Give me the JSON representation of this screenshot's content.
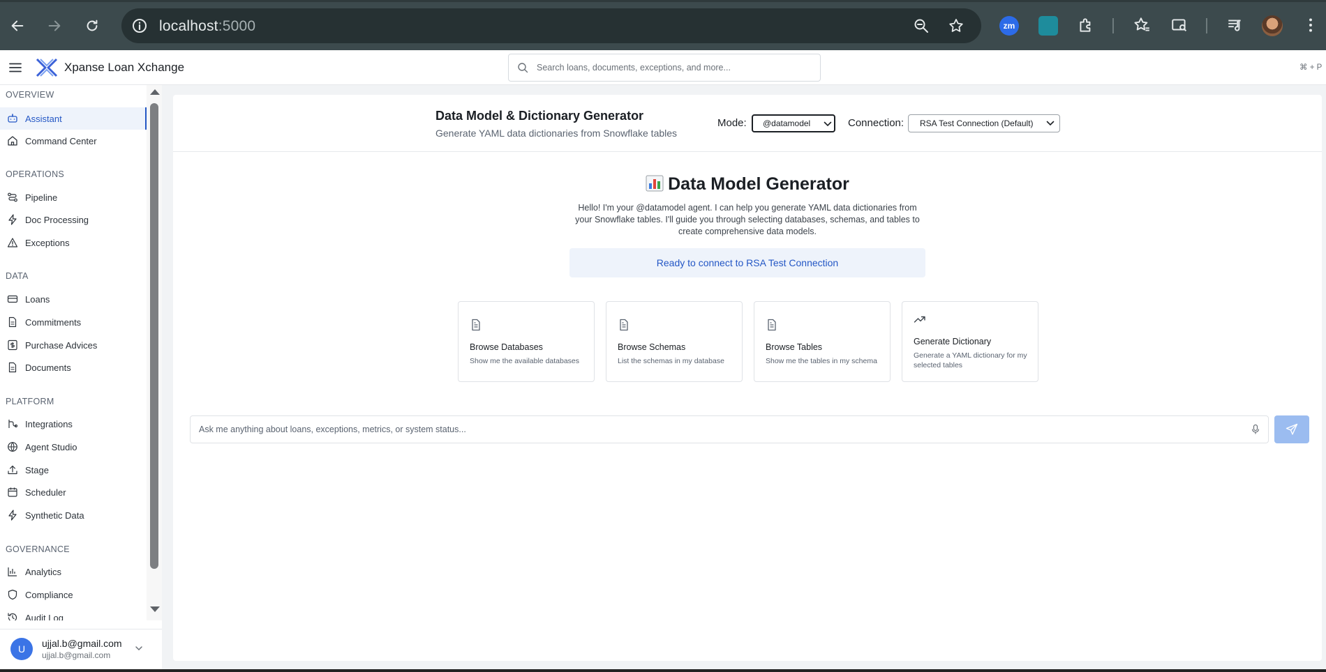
{
  "browser": {
    "url_host": "localhost",
    "url_port": ":5000"
  },
  "header": {
    "brand": "Xpanse Loan Xchange",
    "search_placeholder": "Search loans, documents, exceptions, and more...",
    "shortcut": "⌘ + P"
  },
  "sidebar": {
    "sections": [
      {
        "title": "OVERVIEW",
        "items": [
          {
            "label": "Assistant",
            "icon": "bot-icon",
            "active": true
          },
          {
            "label": "Command Center",
            "icon": "home-icon"
          }
        ]
      },
      {
        "title": "OPERATIONS",
        "items": [
          {
            "label": "Pipeline",
            "icon": "workflow-icon"
          },
          {
            "label": "Doc Processing",
            "icon": "bolt-icon"
          },
          {
            "label": "Exceptions",
            "icon": "warning-icon"
          }
        ]
      },
      {
        "title": "DATA",
        "items": [
          {
            "label": "Loans",
            "icon": "card-icon"
          },
          {
            "label": "Commitments",
            "icon": "file-icon"
          },
          {
            "label": "Purchase Advices",
            "icon": "dollar-icon"
          },
          {
            "label": "Documents",
            "icon": "file-icon"
          }
        ]
      },
      {
        "title": "PLATFORM",
        "items": [
          {
            "label": "Integrations",
            "icon": "integrations-icon"
          },
          {
            "label": "Agent Studio",
            "icon": "globe-icon"
          },
          {
            "label": "Stage",
            "icon": "upload-icon"
          },
          {
            "label": "Scheduler",
            "icon": "calendar-icon"
          },
          {
            "label": "Synthetic Data",
            "icon": "bolt-icon"
          }
        ]
      },
      {
        "title": "GOVERNANCE",
        "items": [
          {
            "label": "Analytics",
            "icon": "bar-chart-icon"
          },
          {
            "label": "Compliance",
            "icon": "shield-icon"
          },
          {
            "label": "Audit Log",
            "icon": "history-icon"
          }
        ]
      }
    ],
    "user": {
      "initial": "U",
      "name": "ujjal.b@gmail.com",
      "email": "ujjal.b@gmail.com"
    }
  },
  "main": {
    "title": "Data Model & Dictionary Generator",
    "subtitle": "Generate YAML data dictionaries from Snowflake tables",
    "mode_label": "Mode:",
    "mode_value": "@datamodel",
    "connection_label": "Connection:",
    "connection_value": "RSA Test Connection (Default)",
    "hero_title": "Data Model Generator",
    "hero_desc": "Hello! I'm your @datamodel agent. I can help you generate YAML data dictionaries from your Snowflake tables. I'll guide you through selecting databases, schemas, and tables to create comprehensive data models.",
    "status": "Ready to connect to RSA Test Connection",
    "cards": [
      {
        "title": "Browse Databases",
        "desc": "Show me the available databases",
        "icon": "document-icon"
      },
      {
        "title": "Browse Schemas",
        "desc": "List the schemas in my database",
        "icon": "document-icon"
      },
      {
        "title": "Browse Tables",
        "desc": "Show me the tables in my schema",
        "icon": "document-icon"
      },
      {
        "title": "Generate Dictionary",
        "desc": "Generate a YAML dictionary for my selected tables",
        "icon": "trending-up-icon"
      }
    ],
    "ask_placeholder": "Ask me anything about loans, exceptions, metrics, or system status..."
  },
  "colors": {
    "accent": "#2457c5",
    "active_bg": "#eef3fb",
    "send_button": "#9bbcf0",
    "chrome": "#3c4a4d"
  }
}
